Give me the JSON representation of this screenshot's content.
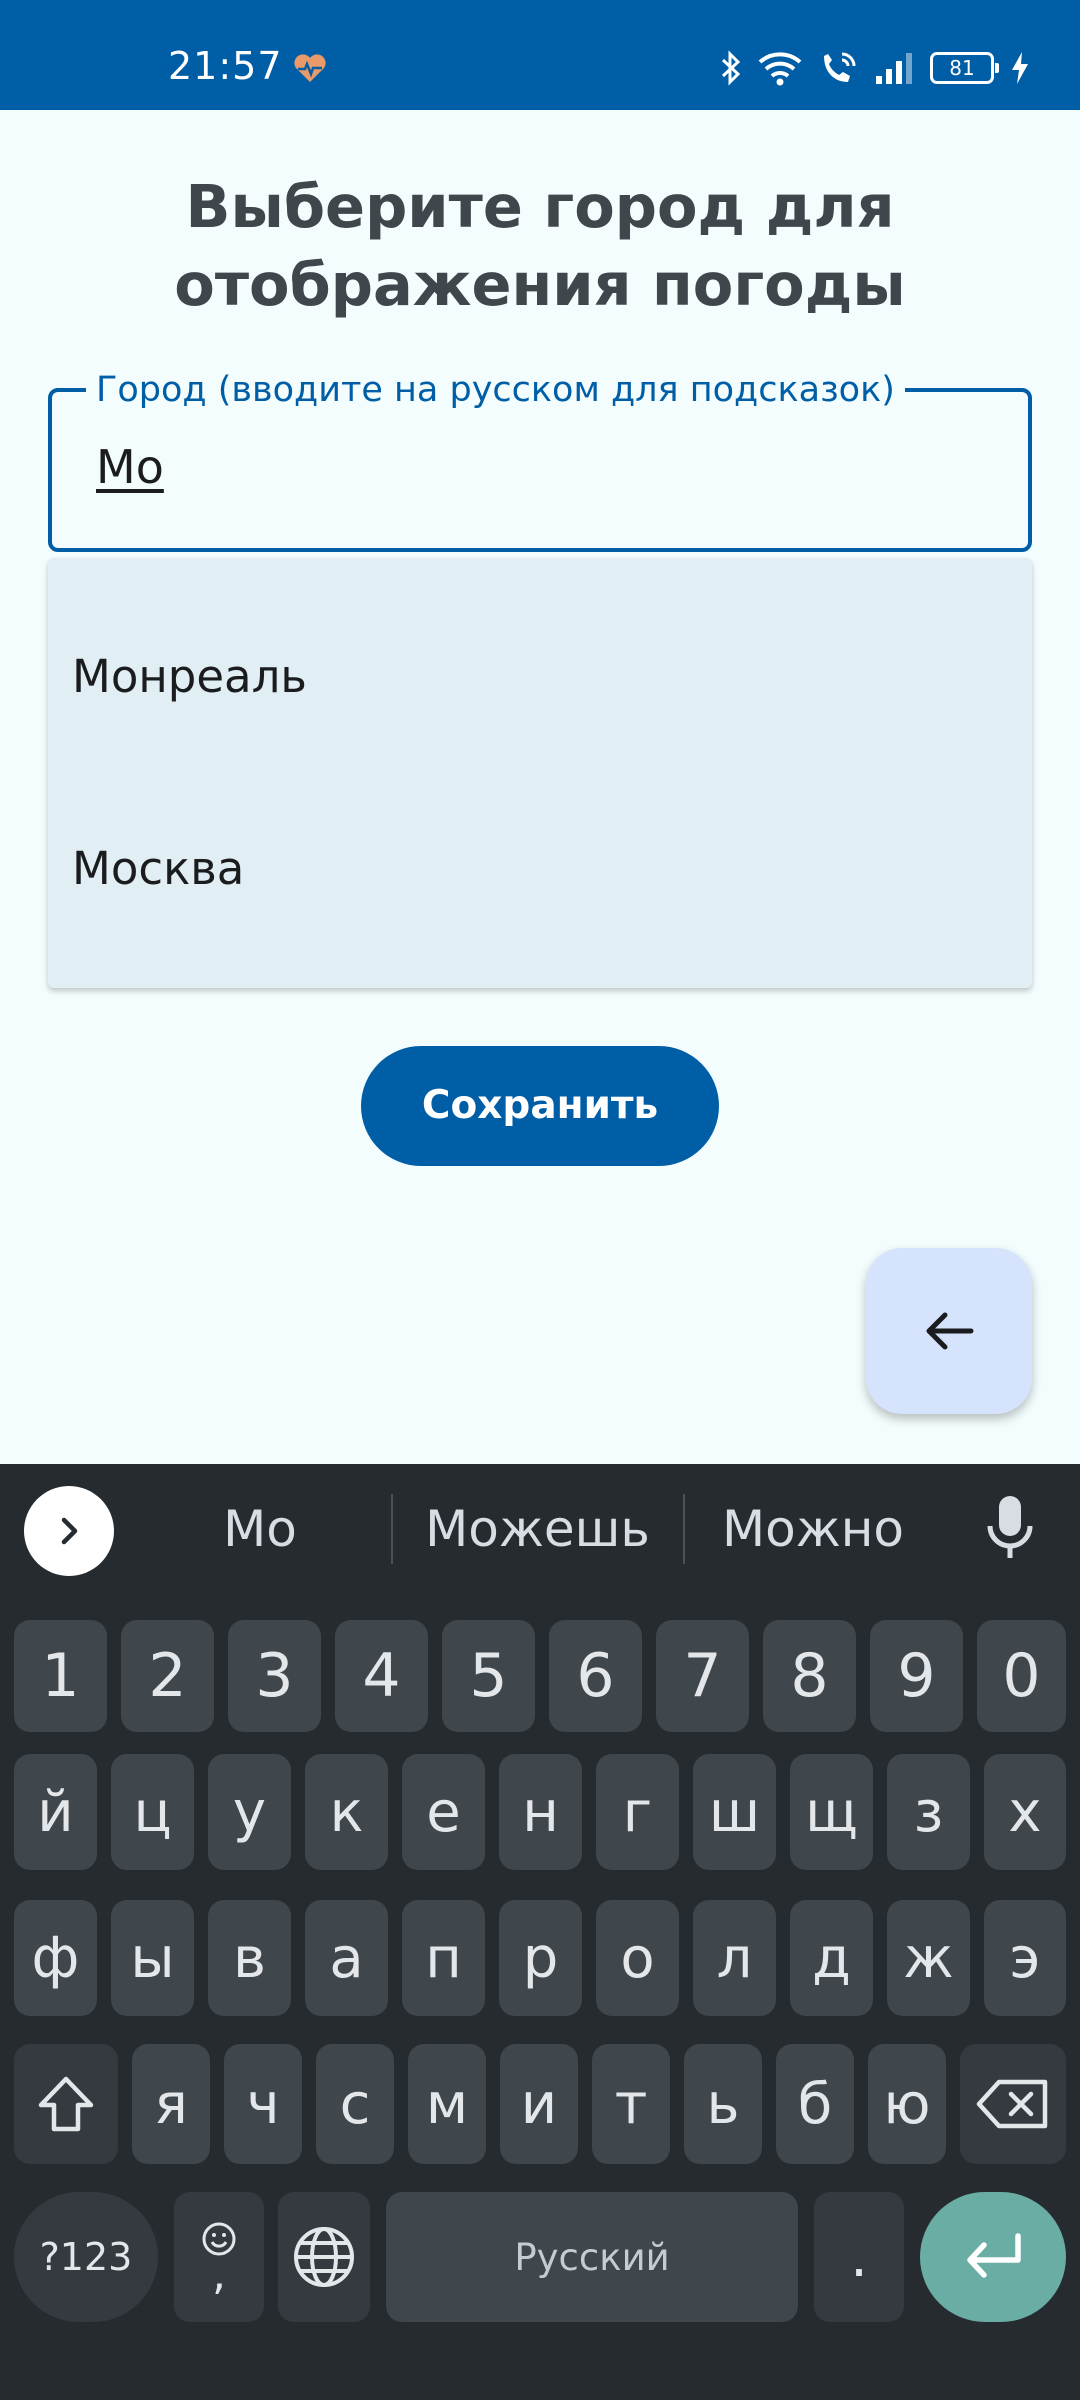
{
  "status_bar": {
    "time": "21:57",
    "battery": "81"
  },
  "page": {
    "title_line1": "Выберите город для",
    "title_line2": "отображения погоды"
  },
  "city_field": {
    "label": "Город (вводите на русском для подсказок)",
    "value": "Мо"
  },
  "suggestions": [
    "Монреаль",
    "Москва"
  ],
  "save_button": {
    "label": "Сохранить"
  },
  "keyboard": {
    "suggestion_words": [
      "Мо",
      "Можешь",
      "Можно"
    ],
    "row_numbers": [
      "1",
      "2",
      "3",
      "4",
      "5",
      "6",
      "7",
      "8",
      "9",
      "0"
    ],
    "row1": [
      "й",
      "ц",
      "у",
      "к",
      "е",
      "н",
      "г",
      "ш",
      "щ",
      "з",
      "х"
    ],
    "row2": [
      "ф",
      "ы",
      "в",
      "а",
      "п",
      "р",
      "о",
      "л",
      "д",
      "ж",
      "э"
    ],
    "row3": [
      "я",
      "ч",
      "с",
      "м",
      "и",
      "т",
      "ь",
      "б",
      "ю"
    ],
    "symbols_label": "?123",
    "comma_label": ",",
    "space_label": "Русский",
    "period_label": "."
  },
  "colors": {
    "primary": "#005ea6",
    "background": "#f3fdfd",
    "dropdown": "#e1eef4",
    "fab": "#d5e3fd",
    "keyboard_bg": "#262b30",
    "key_bg": "#3f464c",
    "enter_key": "#6aada5"
  },
  "icons": {
    "status": [
      "heart-pulse-icon",
      "bluetooth-icon",
      "wifi-icon",
      "wifi-calling-icon",
      "signal-icon",
      "battery-icon",
      "charging-icon"
    ],
    "fab": "arrow-back-icon",
    "keyboard": [
      "chevron-right-icon",
      "mic-icon",
      "shift-icon",
      "emoji-icon",
      "globe-icon",
      "backspace-icon",
      "enter-icon"
    ]
  }
}
